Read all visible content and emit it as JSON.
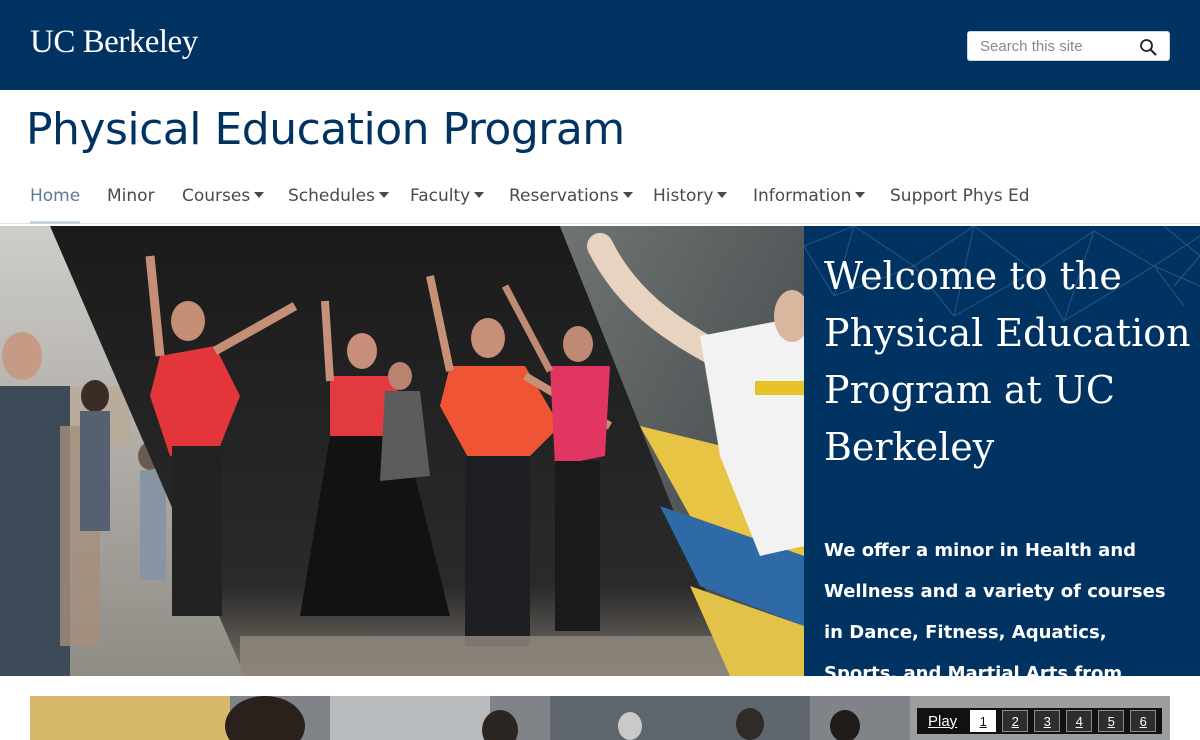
{
  "header": {
    "logo_text": "UC Berkeley",
    "search_placeholder": "Search this site"
  },
  "site_title": "Physical Education Program",
  "nav": {
    "items": [
      {
        "label": "Home",
        "dropdown": false,
        "active": true
      },
      {
        "label": "Minor",
        "dropdown": false
      },
      {
        "label": "Courses",
        "dropdown": true
      },
      {
        "label": "Schedules",
        "dropdown": true
      },
      {
        "label": "Faculty",
        "dropdown": true
      },
      {
        "label": "Reservations",
        "dropdown": true
      },
      {
        "label": "History",
        "dropdown": true
      },
      {
        "label": "Information",
        "dropdown": true
      },
      {
        "label": "Support Phys Ed",
        "dropdown": false
      }
    ]
  },
  "hero": {
    "title": "Welcome to the Physical Education Program at UC Berkeley",
    "text": "We offer a minor in Health and Wellness and a variety of courses in Dance, Fitness, Aquatics, Sports, and Martial Arts from beginning through"
  },
  "slideshow": {
    "play_label": "Play",
    "pages": [
      "1",
      "2",
      "3",
      "4",
      "5",
      "6"
    ],
    "current_page": "1"
  },
  "colors": {
    "berkeley_blue": "#003262",
    "nav_active": "#5d7a95"
  }
}
